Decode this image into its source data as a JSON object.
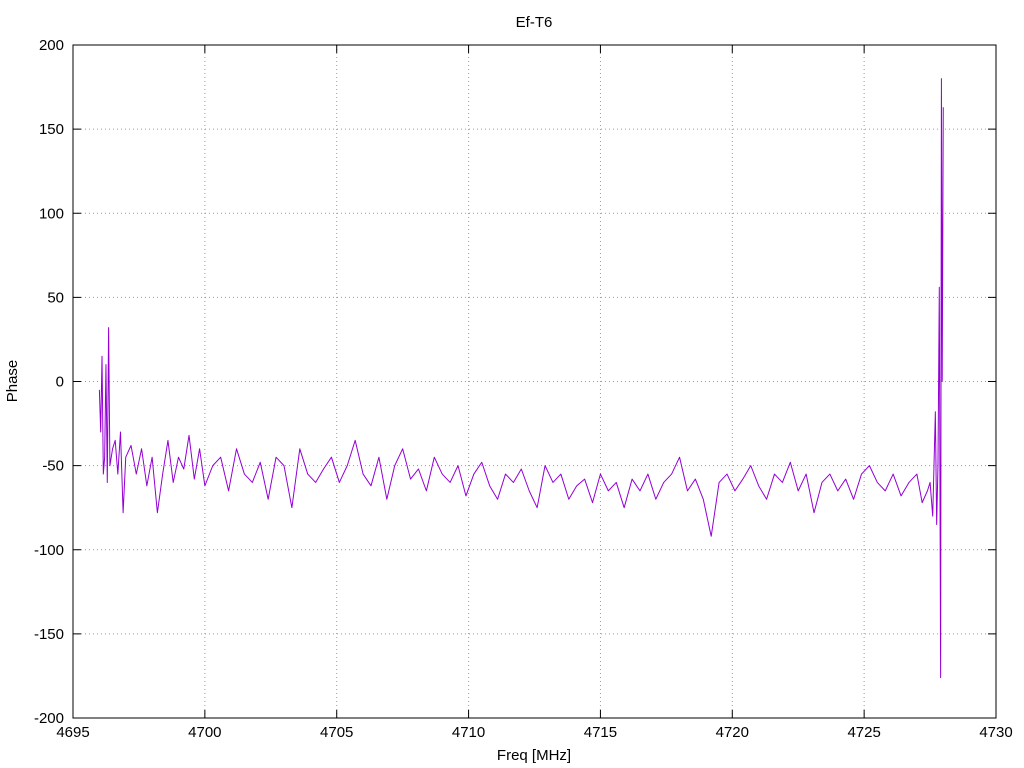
{
  "chart_data": {
    "type": "line",
    "title": "Ef-T6",
    "xlabel": "Freq [MHz]",
    "ylabel": "Phase",
    "xlim": [
      4695,
      4730
    ],
    "ylim": [
      -200,
      200
    ],
    "xticks": [
      4695,
      4700,
      4705,
      4710,
      4715,
      4720,
      4725,
      4730
    ],
    "yticks": [
      -200,
      -150,
      -100,
      -50,
      0,
      50,
      100,
      150,
      200
    ],
    "grid": true,
    "grid_style": "dotted",
    "legend": "none",
    "series": [
      {
        "color": "#9400d3",
        "x": [
          4696.0,
          4696.05,
          4696.1,
          4696.15,
          4696.2,
          4696.25,
          4696.3,
          4696.35,
          4696.4,
          4696.5,
          4696.6,
          4696.7,
          4696.8,
          4696.9,
          4697.0,
          4697.2,
          4697.4,
          4697.6,
          4697.8,
          4698.0,
          4698.2,
          4698.4,
          4698.6,
          4698.8,
          4699.0,
          4699.2,
          4699.4,
          4699.6,
          4699.8,
          4700.0,
          4700.3,
          4700.6,
          4700.9,
          4701.2,
          4701.5,
          4701.8,
          4702.1,
          4702.4,
          4702.7,
          4703.0,
          4703.3,
          4703.6,
          4703.9,
          4704.2,
          4704.5,
          4704.8,
          4705.1,
          4705.4,
          4705.7,
          4706.0,
          4706.3,
          4706.6,
          4706.9,
          4707.2,
          4707.5,
          4707.8,
          4708.1,
          4708.4,
          4708.7,
          4709.0,
          4709.3,
          4709.6,
          4709.9,
          4710.2,
          4710.5,
          4710.8,
          4711.1,
          4711.4,
          4711.7,
          4712.0,
          4712.3,
          4712.6,
          4712.9,
          4713.2,
          4713.5,
          4713.8,
          4714.1,
          4714.4,
          4714.7,
          4715.0,
          4715.3,
          4715.6,
          4715.9,
          4716.2,
          4716.5,
          4716.8,
          4717.1,
          4717.4,
          4717.7,
          4718.0,
          4718.3,
          4718.6,
          4718.9,
          4719.2,
          4719.5,
          4719.8,
          4720.1,
          4720.4,
          4720.7,
          4721.0,
          4721.3,
          4721.6,
          4721.9,
          4722.2,
          4722.5,
          4722.8,
          4723.1,
          4723.4,
          4723.7,
          4724.0,
          4724.3,
          4724.6,
          4724.9,
          4725.2,
          4725.5,
          4725.8,
          4726.1,
          4726.4,
          4726.7,
          4727.0,
          4727.2,
          4727.4,
          4727.5,
          4727.6,
          4727.7,
          4727.75,
          4727.8,
          4727.85,
          4727.9,
          4727.93,
          4727.96,
          4728.0
        ],
        "y": [
          -5,
          -30,
          15,
          -55,
          -45,
          10,
          -60,
          32,
          -50,
          -40,
          -35,
          -55,
          -30,
          -78,
          -45,
          -38,
          -55,
          -40,
          -62,
          -45,
          -78,
          -55,
          -35,
          -60,
          -45,
          -52,
          -32,
          -58,
          -40,
          -62,
          -50,
          -45,
          -65,
          -40,
          -55,
          -60,
          -48,
          -70,
          -45,
          -50,
          -75,
          -40,
          -55,
          -60,
          -52,
          -45,
          -60,
          -50,
          -35,
          -55,
          -62,
          -45,
          -70,
          -50,
          -40,
          -58,
          -52,
          -65,
          -45,
          -55,
          -60,
          -50,
          -68,
          -55,
          -48,
          -62,
          -70,
          -55,
          -60,
          -52,
          -65,
          -75,
          -50,
          -60,
          -55,
          -70,
          -62,
          -58,
          -72,
          -55,
          -65,
          -60,
          -75,
          -58,
          -65,
          -55,
          -70,
          -60,
          -55,
          -45,
          -65,
          -58,
          -70,
          -92,
          -60,
          -55,
          -65,
          -58,
          -50,
          -62,
          -70,
          -55,
          -60,
          -48,
          -65,
          -55,
          -78,
          -60,
          -55,
          -65,
          -58,
          -70,
          -55,
          -50,
          -60,
          -65,
          -55,
          -68,
          -60,
          -55,
          -72,
          -65,
          -60,
          -80,
          -18,
          -85,
          -50,
          56,
          -176,
          180,
          0,
          163
        ]
      }
    ]
  }
}
